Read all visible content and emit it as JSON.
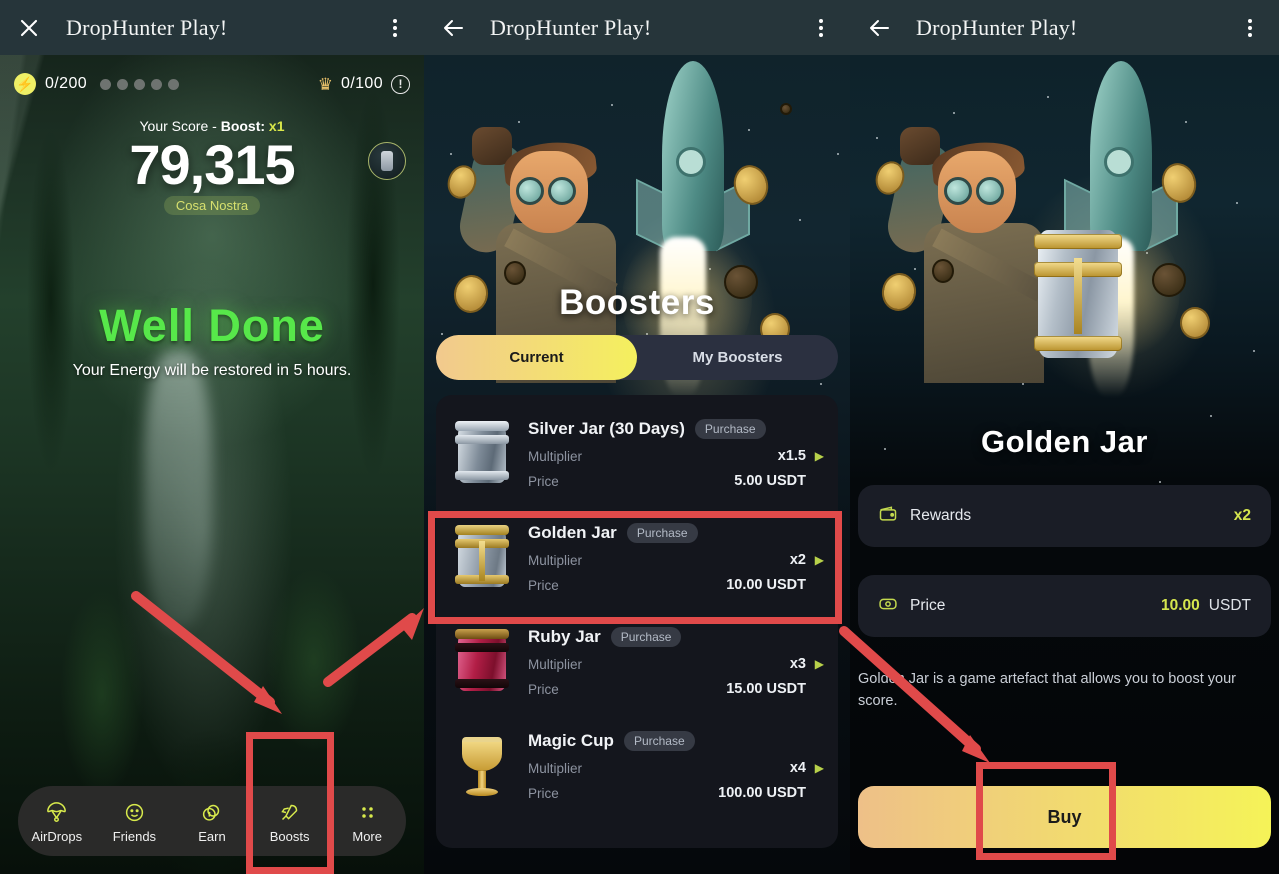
{
  "app": {
    "title": "DropHunter Play!"
  },
  "panel1": {
    "appbar": {
      "title": "DropHunter Play!",
      "close_icon": "close-icon",
      "menu_icon": "overflow-menu-icon"
    },
    "hud": {
      "energy_icon": "bolt-icon",
      "energy": "0/200",
      "energy_dots": 5,
      "crown_icon": "crown-icon",
      "keys": "0/100",
      "info_icon": "info-icon"
    },
    "score": {
      "label_prefix": "Your Score - ",
      "label_boost": "Boost:",
      "multiplier": "x1",
      "value": "79,315",
      "tag": "Cosa Nostra"
    },
    "message": {
      "title": "Well Done",
      "subtitle": "Your Energy will be restored in 5 hours."
    },
    "nav": [
      {
        "label": "AirDrops",
        "icon": "parachute-icon"
      },
      {
        "label": "Friends",
        "icon": "smiley-icon"
      },
      {
        "label": "Earn",
        "icon": "coins-icon"
      },
      {
        "label": "Boosts",
        "icon": "rocket-icon"
      },
      {
        "label": "More",
        "icon": "grid-dots-icon"
      }
    ]
  },
  "panel2": {
    "appbar": {
      "title": "DropHunter Play!",
      "back_icon": "back-arrow-icon",
      "menu_icon": "overflow-menu-icon"
    },
    "hero_title": "Boosters",
    "tabs": [
      {
        "label": "Current",
        "active": true
      },
      {
        "label": "My Boosters",
        "active": false
      }
    ],
    "labels": {
      "multiplier": "Multiplier",
      "price": "Price",
      "badge": "Purchase"
    },
    "boosters": [
      {
        "name": "Silver Jar (30 Days)",
        "badge": "Purchase",
        "multiplier_label": "Multiplier",
        "multiplier": "x1.5",
        "price_label": "Price",
        "price": "5.00 USDT",
        "art": "silver-jar"
      },
      {
        "name": "Golden Jar",
        "badge": "Purchase",
        "multiplier_label": "Multiplier",
        "multiplier": "x2",
        "price_label": "Price",
        "price": "10.00 USDT",
        "art": "golden-jar"
      },
      {
        "name": "Ruby Jar",
        "badge": "Purchase",
        "multiplier_label": "Multiplier",
        "multiplier": "x3",
        "price_label": "Price",
        "price": "15.00 USDT",
        "art": "ruby-jar"
      },
      {
        "name": "Magic Cup",
        "badge": "Purchase",
        "multiplier_label": "Multiplier",
        "multiplier": "x4",
        "price_label": "Price",
        "price": "100.00 USDT",
        "art": "magic-cup"
      }
    ]
  },
  "panel3": {
    "appbar": {
      "title": "DropHunter Play!",
      "back_icon": "back-arrow-icon",
      "menu_icon": "overflow-menu-icon"
    },
    "title": "Golden Jar",
    "rewards": {
      "icon": "wallet-icon",
      "label": "Rewards",
      "value": "x2"
    },
    "price": {
      "icon": "money-icon",
      "label": "Price",
      "value": "10.00",
      "unit": "USDT"
    },
    "description": "Golden Jar is a game artefact that allows you to boost your score.",
    "buy_label": "Buy"
  },
  "annotations": {
    "highlight_color": "#e04a4a",
    "boxes": [
      "boosts-nav-highlight",
      "golden-jar-row-highlight",
      "buy-button-highlight"
    ],
    "arrows": [
      "arrow-to-boosts",
      "arrow-from-boosts-to-list",
      "arrow-to-buy"
    ]
  }
}
